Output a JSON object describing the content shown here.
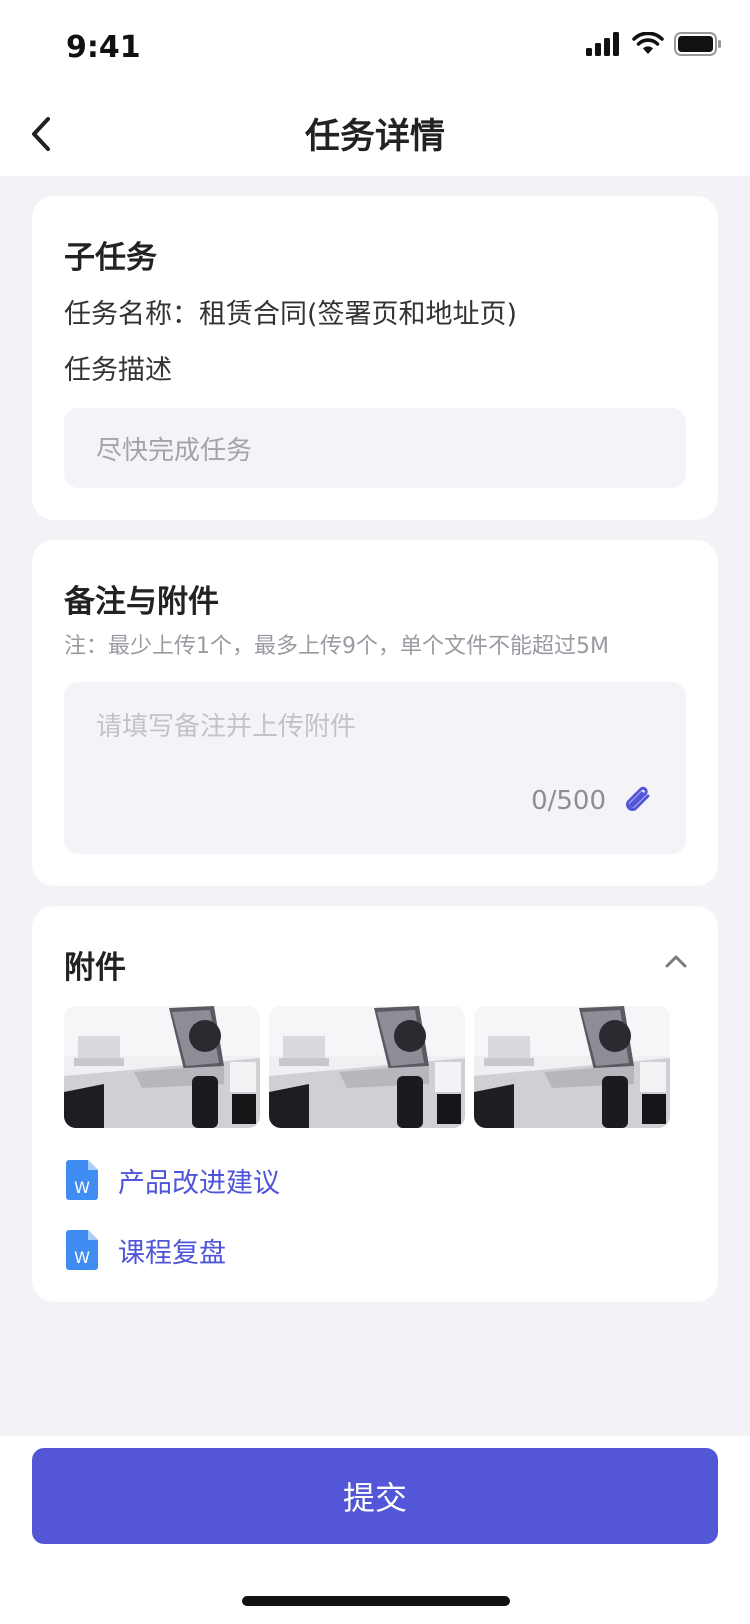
{
  "status": {
    "time": "9:41"
  },
  "nav": {
    "title": "任务详情"
  },
  "subtask": {
    "title": "子任务",
    "name_line": "任务名称：租赁合同(签署页和地址页)",
    "desc_label": "任务描述",
    "desc_value": "尽快完成任务"
  },
  "remarks": {
    "title": "备注与附件",
    "note": "注：最少上传1个，最多上传9个，单个文件不能超过5M",
    "placeholder": "请填写备注并上传附件",
    "counter": "0/500"
  },
  "attachments": {
    "title": "附件",
    "files": [
      {
        "name": "产品改进建议",
        "icon": "word-file-icon"
      },
      {
        "name": "课程复盘",
        "icon": "word-file-icon"
      }
    ],
    "thumbnails": 3
  },
  "colors": {
    "accent": "#5356d6",
    "link": "#4f55d8",
    "background": "#f2f2f7"
  },
  "submit": {
    "label": "提交"
  }
}
